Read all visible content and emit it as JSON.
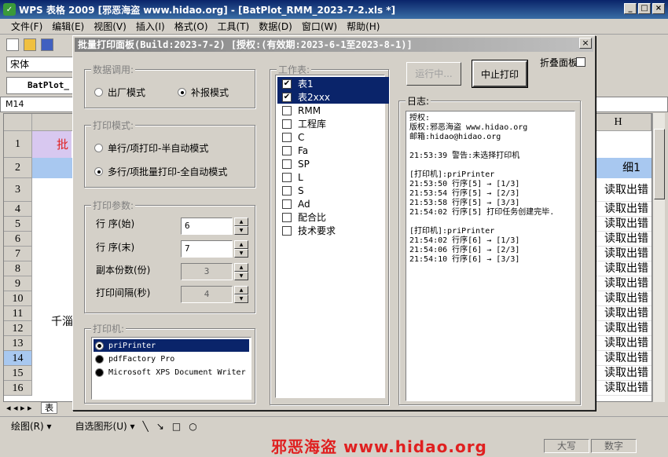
{
  "window": {
    "title": "WPS 表格 2009 [邪恶海盗 www.hidao.org] - [BatPlot_RMM_2023-7-2.xls *]"
  },
  "menu": [
    "文件(F)",
    "编辑(E)",
    "视图(V)",
    "插入(I)",
    "格式(O)",
    "工具(T)",
    "数据(D)",
    "窗口(W)",
    "帮助(H)"
  ],
  "font_name": "宋体",
  "workbook_tab": "BatPlot_",
  "name_box": "M14",
  "sheet": {
    "col_h": "H",
    "rows": [
      "1",
      "2",
      "3",
      "4",
      "5",
      "6",
      "7",
      "8",
      "9",
      "10",
      "11",
      "12",
      "13",
      "14",
      "15",
      "16"
    ],
    "row1_text": "批",
    "row11_text": "千淄",
    "h_row2": "细1",
    "h_values": [
      "读取出错",
      "读取出错",
      "读取出错",
      "读取出错",
      "读取出错",
      "读取出错",
      "读取出错",
      "读取出错",
      "读取出错",
      "读取出错",
      "读取出错",
      "读取出错",
      "读取出错",
      "读取出错"
    ],
    "tab_label": "表"
  },
  "drawbar": {
    "draw": "绘图(R) ▾",
    "autoshape": "自选图形(U) ▾"
  },
  "watermark": "邪恶海盗 www.hidao.org",
  "status": {
    "caps": "大写",
    "num": "数字"
  },
  "dialog": {
    "title": "批量打印面板(Build:2023-7-2) [授权:(有效期:2023-6-1至2023-8-1)]",
    "data_group": "数据调用:",
    "mode_factory": "出厂模式",
    "mode_supplement": "补报模式",
    "print_mode_group": "打印模式:",
    "single_mode": "单行/项打印-半自动模式",
    "multi_mode": "多行/项批量打印-全自动模式",
    "params_group": "打印参数:",
    "row_start_label": "行 序(始)",
    "row_start": "6",
    "row_end_label": "行 序(末)",
    "row_end": "7",
    "copies_label": "副本份数(份)",
    "copies": "3",
    "interval_label": "打印间隔(秒)",
    "interval": "4",
    "printer_group": "打印机:",
    "printers": [
      "priPrinter",
      "pdfFactory Pro",
      "Microsoft XPS Document Writer"
    ],
    "sheets_group": "工作表:",
    "sheets": [
      {
        "name": "表1",
        "checked": true
      },
      {
        "name": "表2xxx",
        "checked": true
      },
      {
        "name": "RMM",
        "checked": false
      },
      {
        "name": "工程库",
        "checked": false
      },
      {
        "name": "C",
        "checked": false
      },
      {
        "name": "Fa",
        "checked": false
      },
      {
        "name": "SP",
        "checked": false
      },
      {
        "name": "L",
        "checked": false
      },
      {
        "name": "S",
        "checked": false
      },
      {
        "name": "Ad",
        "checked": false
      },
      {
        "name": "配合比",
        "checked": false
      },
      {
        "name": "技术要求",
        "checked": false
      }
    ],
    "run_button": "运行中...",
    "stop_button": "中止打印",
    "fold_label": "折叠面板",
    "log_label": "日志:",
    "log": "授权:\n版权:邪恶海盗 www.hidao.org\n邮箱:hidao@hidao.org\n\n21:53:39 警告:未选择打印机\n\n[打印机]:priPrinter\n21:53:50 行序[5] → [1/3]\n21:53:54 行序[5] → [2/3]\n21:53:58 行序[5] → [3/3]\n21:54:02 行序[5] 打印任务创建完毕.\n\n[打印机]:priPrinter\n21:54:02 行序[6] → [1/3]\n21:54:06 行序[6] → [2/3]\n21:54:10 行序[6] → [3/3]"
  }
}
